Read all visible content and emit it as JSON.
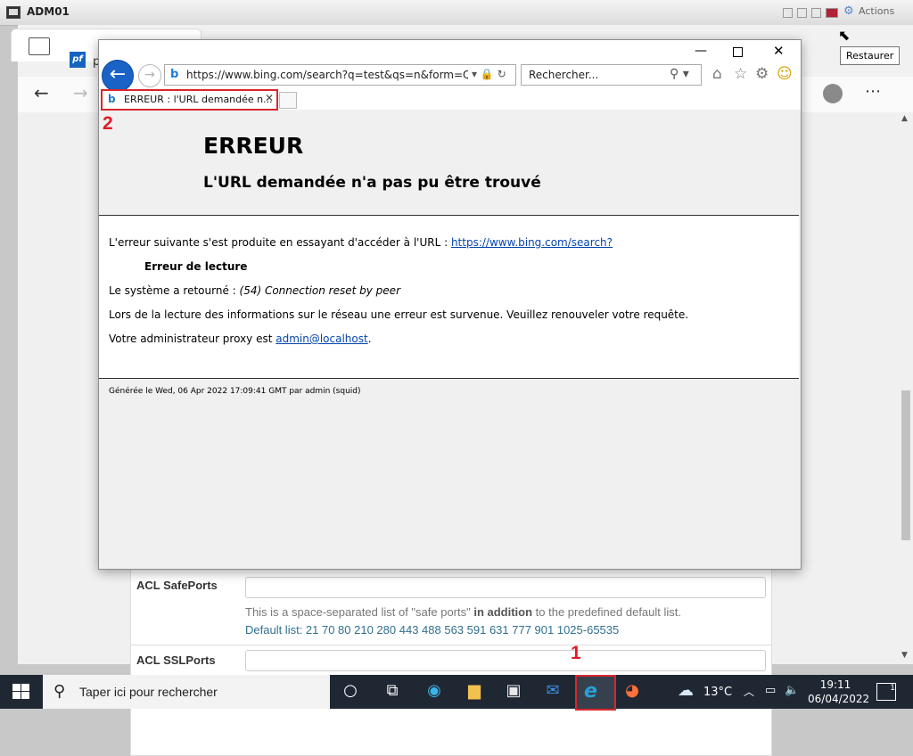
{
  "vm": {
    "title": "ADM01",
    "actions_label": "Actions",
    "tooltip": "Restaurer"
  },
  "background_page": {
    "tab_initial": "p",
    "acl_safeports_label": "ACL SafePorts",
    "acl_help_prefix": "This is a space-separated list of \"safe ports\" ",
    "acl_help_bold": "in addition",
    "acl_help_suffix": " to the predefined default list.",
    "acl_default_list": "Default list: 21 70 80 210 280 443 488 563 591 631 777 901 1025-65535",
    "acl_sslports_label": "ACL SSLPorts"
  },
  "ie": {
    "address_url": "https://www.bing.com/search?q=test&qs=n&form=QBRE&",
    "search_placeholder": "Rechercher...",
    "tab_title": "ERREUR : l'URL demandée n...",
    "annotation_tab": "2"
  },
  "error_page": {
    "title": "ERREUR",
    "subtitle": "L'URL demandée n'a pas pu être trouvé",
    "line1_prefix": "L'erreur suivante s'est produite en essayant d'accéder à l'URL : ",
    "line1_link": "https://www.bing.com/search?",
    "read_error": "Erreur de lecture",
    "system_prefix": "Le système a retourné : ",
    "system_value": "(54) Connection reset by peer",
    "network_msg": "Lors de la lecture des informations sur le réseau une erreur est survenue. Veuillez renouveler votre requête.",
    "admin_prefix": "Votre administrateur proxy est ",
    "admin_link": "admin@localhost",
    "admin_suffix": ".",
    "footer": "Générée le Wed, 06 Apr 2022 17:09:41 GMT par admin (squid)"
  },
  "taskbar": {
    "search_text": "Taper ici pour rechercher",
    "temperature": "13°C",
    "time": "19:11",
    "date": "06/04/2022",
    "notification_count": "1",
    "annotation_ie": "1"
  },
  "colors": {
    "annotation_red": "#e01b24",
    "ie_blue": "#1a62c5",
    "taskbar": "#1f2733",
    "link": "#0645ad"
  }
}
